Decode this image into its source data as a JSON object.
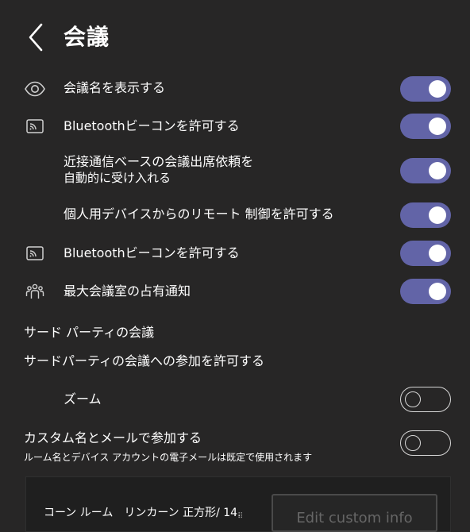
{
  "header": {
    "title": "会議",
    "back_icon": "chevron-left-icon"
  },
  "settings": [
    {
      "label": "会議名を表示する",
      "icon": "eye-icon",
      "state": "on"
    },
    {
      "label": "Bluetoothビーコンを許可する",
      "icon": "cast-icon",
      "state": "on"
    },
    {
      "label": "近接通信ベースの会議出席依頼を自動的に受け入れる",
      "label_line1": "近接通信ベースの会議出席依頼を",
      "label_line2": "自動的に受け入れる",
      "icon": "",
      "state": "on"
    },
    {
      "label": "個人用デバイスからのリモート 制御を許可する",
      "icon": "",
      "state": "on"
    },
    {
      "label": "Bluetoothビーコンを許可する",
      "icon": "cast-icon",
      "state": "on"
    },
    {
      "label": "最大会議室の占有通知",
      "icon": "people-group-icon",
      "state": "on"
    }
  ],
  "third_party": {
    "section_title": "サード パーティの会議",
    "allow_label": "サードパーティの会議への参加を許可する",
    "zoom_label": "ズーム",
    "zoom_state": "off"
  },
  "custom_join": {
    "label": "カスタム名とメールで参加する",
    "description": "ルーム名とデバイス アカウントの電子メールは既定で使用されます",
    "state": "off"
  },
  "card": {
    "room_label": "コーン ルーム　リンカーン 正方形/ 14.",
    "button_label": "Edit custom info"
  },
  "colors": {
    "background": "#272626",
    "toggle_on": "#6264a7",
    "text": "#ffffff"
  }
}
